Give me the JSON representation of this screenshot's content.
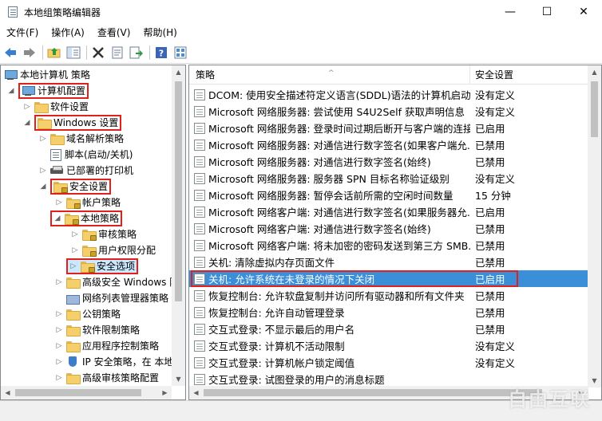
{
  "window": {
    "title": "本地组策略编辑器",
    "minimize": "—",
    "maximize": "☐",
    "close": "✕"
  },
  "menu": [
    "文件(F)",
    "操作(A)",
    "查看(V)",
    "帮助(H)"
  ],
  "toolbar_icons": [
    "back-icon",
    "forward-icon",
    "up-folder-icon",
    "show-hide-tree-icon",
    "delete-icon",
    "properties-icon",
    "export-icon",
    "help-icon",
    "view-icon"
  ],
  "tree": {
    "root": "本地计算机 策略",
    "computer_config": "计算机配置",
    "software_settings": "软件设置",
    "windows_settings": "Windows 设置",
    "dns_policy": "域名解析策略",
    "scripts": "脚本(启动/关机)",
    "printers": "已部署的打印机",
    "security_settings": "安全设置",
    "account_policies": "帐户策略",
    "local_policies": "本地策略",
    "audit_policy": "审核策略",
    "user_rights": "用户权限分配",
    "security_options": "安全选项",
    "advanced_firewall": "高级安全 Windows 防",
    "network_list": "网络列表管理器策略",
    "public_key": "公钥策略",
    "software_restriction": "软件限制策略",
    "app_control": "应用程序控制策略",
    "ip_security": "IP 安全策略，在 本地",
    "advanced_audit": "高级审核策略配置"
  },
  "list": {
    "col_policy": "策略",
    "col_setting": "安全设置",
    "rows": [
      {
        "policy": "DCOM: 使用安全描述符定义语言(SDDL)语法的计算机启动...",
        "setting": "没有定义"
      },
      {
        "policy": "Microsoft 网络服务器: 尝试使用 S4U2Self 获取声明信息",
        "setting": "没有定义"
      },
      {
        "policy": "Microsoft 网络服务器: 登录时间过期后断开与客户端的连接",
        "setting": "已启用"
      },
      {
        "policy": "Microsoft 网络服务器: 对通信进行数字签名(如果客户端允...",
        "setting": "已禁用"
      },
      {
        "policy": "Microsoft 网络服务器: 对通信进行数字签名(始终)",
        "setting": "已禁用"
      },
      {
        "policy": "Microsoft 网络服务器: 服务器 SPN 目标名称验证级别",
        "setting": "没有定义"
      },
      {
        "policy": "Microsoft 网络服务器: 暂停会话前所需的空闲时间数量",
        "setting": "15 分钟"
      },
      {
        "policy": "Microsoft 网络客户端: 对通信进行数字签名(如果服务器允...",
        "setting": "已启用"
      },
      {
        "policy": "Microsoft 网络客户端: 对通信进行数字签名(始终)",
        "setting": "已禁用"
      },
      {
        "policy": "Microsoft 网络客户端: 将未加密的密码发送到第三方 SMB...",
        "setting": "已禁用"
      },
      {
        "policy": "关机: 清除虚拟内存页面文件",
        "setting": "已禁用"
      },
      {
        "policy": "关机: 允许系统在未登录的情况下关闭",
        "setting": "已启用"
      },
      {
        "policy": "恢复控制台: 允许软盘复制并访问所有驱动器和所有文件夹",
        "setting": "已禁用"
      },
      {
        "policy": "恢复控制台: 允许自动管理登录",
        "setting": "已禁用"
      },
      {
        "policy": "交互式登录: 不显示最后的用户名",
        "setting": "已禁用"
      },
      {
        "policy": "交互式登录: 计算机不活动限制",
        "setting": "没有定义"
      },
      {
        "policy": "交互式登录: 计算机帐户锁定阈值",
        "setting": "没有定义"
      },
      {
        "policy": "交互式登录: 试图登录的用户的消息标题",
        "setting": ""
      }
    ],
    "selected_index": 11
  },
  "colors": {
    "highlight_border": "#e0201a",
    "selection": "#3b8fd9",
    "tree_selection": "#cce8ff"
  },
  "watermark": "自由互联"
}
